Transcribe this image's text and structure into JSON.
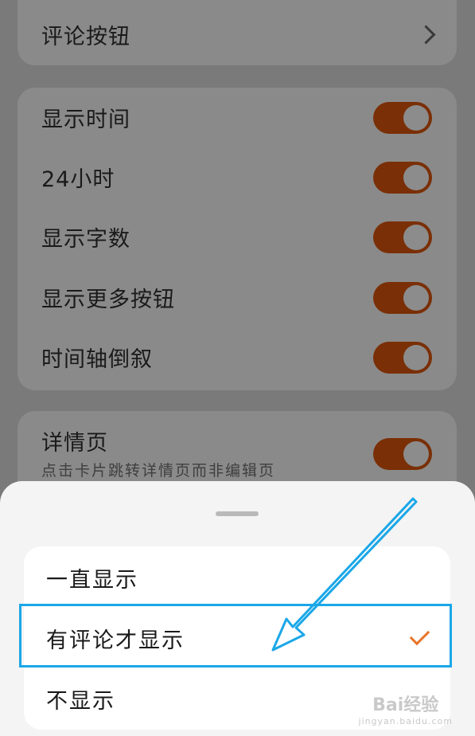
{
  "settings": {
    "comment_button": {
      "label": "评论按钮"
    },
    "toggles": [
      {
        "label": "显示时间",
        "on": true
      },
      {
        "label": "24小时",
        "on": true
      },
      {
        "label": "显示字数",
        "on": true
      },
      {
        "label": "显示更多按钮",
        "on": true
      },
      {
        "label": "时间轴倒叙",
        "on": true
      }
    ],
    "detail_page": {
      "label": "详情页",
      "description": "点击卡片跳转详情页而非编辑页",
      "on": true
    }
  },
  "sheet": {
    "options": [
      {
        "label": "一直显示",
        "selected": false
      },
      {
        "label": "有评论才显示",
        "selected": true
      },
      {
        "label": "不显示",
        "selected": false
      }
    ]
  },
  "watermark": {
    "brand": "Bai经验",
    "url": "jingyan.baidu.com"
  },
  "colors": {
    "toggle_on_dimmed": "#7a2f06",
    "check": "#e8742a",
    "annotation": "#1aa7e8"
  }
}
